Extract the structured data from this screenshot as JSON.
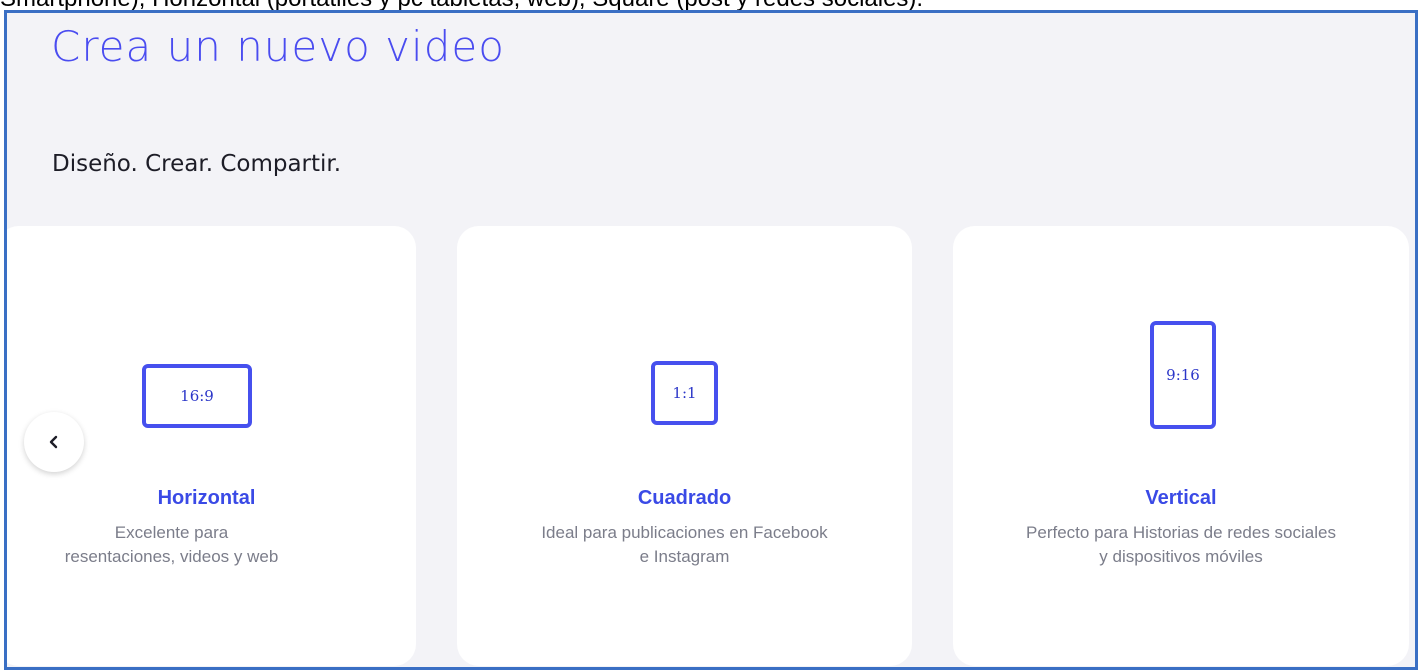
{
  "caption": "Smartphone), Horizontal (portátiles y pc tabletas, web), Square (post y redes sociales).",
  "header": {
    "title": "Crea un nuevo video",
    "subtitle": "Diseño. Crear. Compartir."
  },
  "carousel": {
    "prev_icon": "chevron-left-icon",
    "cards": [
      {
        "ratio": "16:9",
        "title": "Horizontal",
        "description": "Excelente para presentaciones, videos y web",
        "desc_line1": "Excelente para",
        "desc_line2": "resentaciones, videos y web"
      },
      {
        "ratio": "1:1",
        "title": "Cuadrado",
        "description": "Ideal para publicaciones en Facebook e Instagram"
      },
      {
        "ratio": "9:16",
        "title": "Vertical",
        "description": "Perfecto para Historias de redes sociales y dispositivos móviles"
      }
    ]
  },
  "colors": {
    "accent": "#4a4cf0",
    "frame_border": "#3a6fc4",
    "background": "#f3f3f7"
  }
}
